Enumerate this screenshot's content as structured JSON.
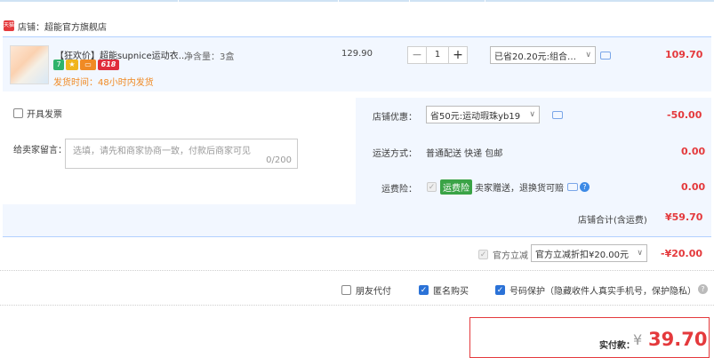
{
  "shop": {
    "tag": "天猫",
    "name": "店铺：超能官方旗舰店"
  },
  "item": {
    "title": "【狂欢价】超能supnice运动衣…",
    "spec": "净含量：3盒",
    "badge_7": "7",
    "badge_618": "618",
    "ship_time": "发货时间：48小时内发货",
    "unit_price": "129.90",
    "quantity": "1",
    "minus": "−",
    "plus": "+",
    "discount_select": "已省20.20元:组合…",
    "subtotal": "109.70"
  },
  "invoice": {
    "label": "开具发票"
  },
  "message": {
    "label": "给卖家留言：",
    "placeholder": "选填，请先和商家协商一致，付款后商家可见",
    "count": "0/200"
  },
  "shop_discount": {
    "label": "店铺优惠：",
    "value": "省50元:运动瑕珠yb19",
    "amount": "-50.00"
  },
  "shipping": {
    "label": "运送方式：",
    "value": "普通配送 快递 包邮",
    "amount": "0.00"
  },
  "insurance": {
    "label": "运费险：",
    "tag": "运费险",
    "text": "卖家赠送，退换货可赔",
    "amount": "0.00"
  },
  "shop_total": {
    "label": "店铺合计(含运费)",
    "amount": "¥59.70"
  },
  "official": {
    "label": "官方立减",
    "select": "官方立减折扣¥20.00元",
    "amount": "-¥20.00"
  },
  "options": {
    "friend_pay": "朋友代付",
    "anonymous": "匿名购买",
    "number_protect": "号码保护（隐藏收件人真实手机号，保护隐私）"
  },
  "payment": {
    "label": "实付款：",
    "currency": "¥",
    "amount": "39.70"
  },
  "colors": {
    "accent_red": "#e4393c",
    "panel_blue": "#f2f7ff",
    "checkbox_blue": "#2b72d7"
  }
}
